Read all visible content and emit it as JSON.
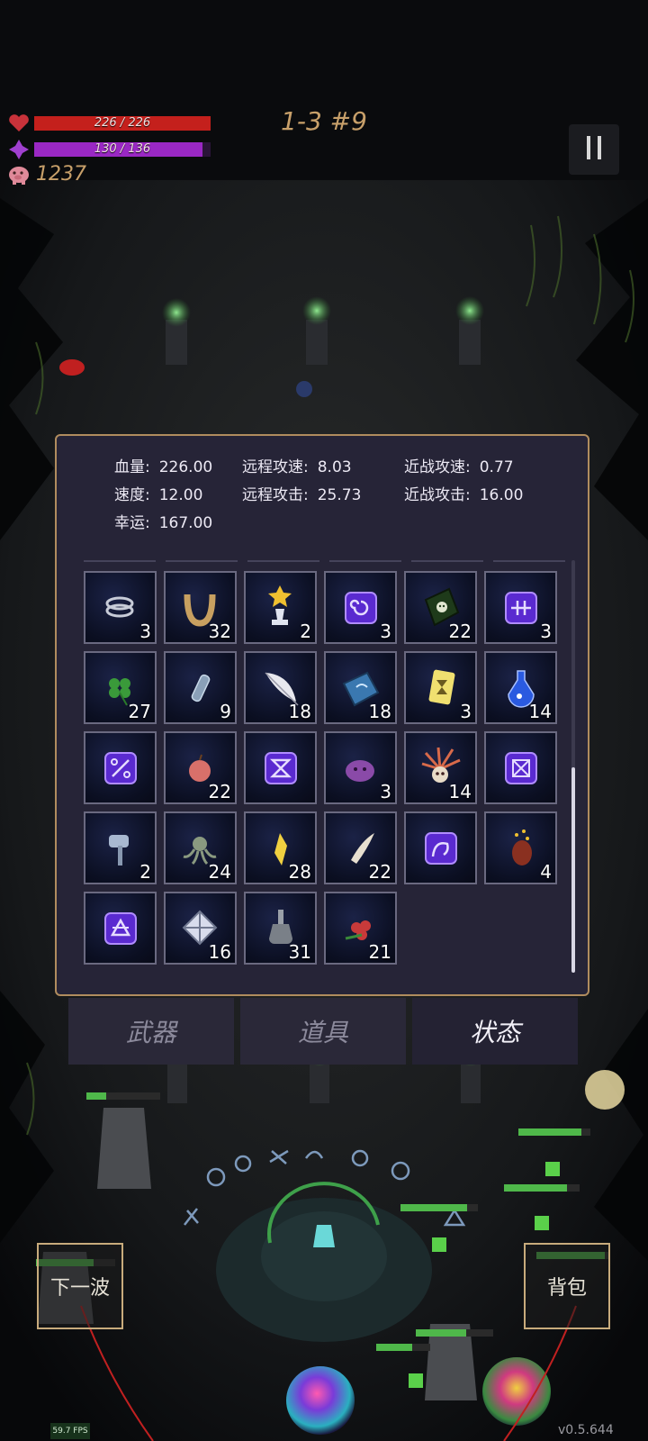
{
  "hud": {
    "hp_text": "226 / 226",
    "hp_fraction": 1.0,
    "mp_text": "130 / 136",
    "mp_fraction": 0.956,
    "gold": "1237",
    "stage": "1-3 #9",
    "colors": {
      "hp": "#c4201c",
      "mp": "#9a28c4",
      "gold": "#c8a06a"
    },
    "icons": [
      "heart-icon",
      "diamond-icon",
      "piggy-bank-icon",
      "pause-icon"
    ]
  },
  "stats": [
    {
      "label": "血量:",
      "value": "226.00"
    },
    {
      "label": "远程攻速:",
      "value": "8.03"
    },
    {
      "label": "近战攻速:",
      "value": "0.77"
    },
    {
      "label": "速度:",
      "value": "12.00"
    },
    {
      "label": "远程攻击:",
      "value": "25.73"
    },
    {
      "label": "近战攻击:",
      "value": "16.00"
    },
    {
      "label": "幸运:",
      "value": "167.00"
    }
  ],
  "inventory": [
    {
      "icon": "rings-icon",
      "count": "3"
    },
    {
      "icon": "horseshoe-icon",
      "count": "32"
    },
    {
      "icon": "star-trophy-icon",
      "count": "2"
    },
    {
      "icon": "rune-swirl-icon",
      "count": "3"
    },
    {
      "icon": "green-tome-icon",
      "count": "22"
    },
    {
      "icon": "rune-cross-icon",
      "count": "3"
    },
    {
      "icon": "clover-icon",
      "count": "27"
    },
    {
      "icon": "vial-icon",
      "count": "9"
    },
    {
      "icon": "feather-icon",
      "count": "18"
    },
    {
      "icon": "blue-book-icon",
      "count": "18"
    },
    {
      "icon": "hourglass-card-icon",
      "count": "3"
    },
    {
      "icon": "potion-icon",
      "count": "14"
    },
    {
      "icon": "rune-percent-icon",
      "count": ""
    },
    {
      "icon": "apple-icon",
      "count": "22"
    },
    {
      "icon": "rune-hourglass-icon",
      "count": ""
    },
    {
      "icon": "slime-icon",
      "count": "3"
    },
    {
      "icon": "spiky-skull-icon",
      "count": "14"
    },
    {
      "icon": "rune-box-x-icon",
      "count": ""
    },
    {
      "icon": "hammer-icon",
      "count": "2"
    },
    {
      "icon": "octopus-icon",
      "count": "24"
    },
    {
      "icon": "crystal-icon",
      "count": "28"
    },
    {
      "icon": "fang-icon",
      "count": "22"
    },
    {
      "icon": "rune-curve-icon",
      "count": ""
    },
    {
      "icon": "beetle-icon",
      "count": "4"
    },
    {
      "icon": "rune-triangle-icon",
      "count": ""
    },
    {
      "icon": "crystal-tiles-icon",
      "count": "16"
    },
    {
      "icon": "flask-icon",
      "count": "31"
    },
    {
      "icon": "flower-icon",
      "count": "21"
    }
  ],
  "tabs": [
    {
      "label": "武器",
      "active": false
    },
    {
      "label": "道具",
      "active": false
    },
    {
      "label": "状态",
      "active": true
    }
  ],
  "buttons": {
    "next_wave": "下一波",
    "backpack": "背包"
  },
  "fps": "59.7 FPS",
  "version": "v0.5.644"
}
